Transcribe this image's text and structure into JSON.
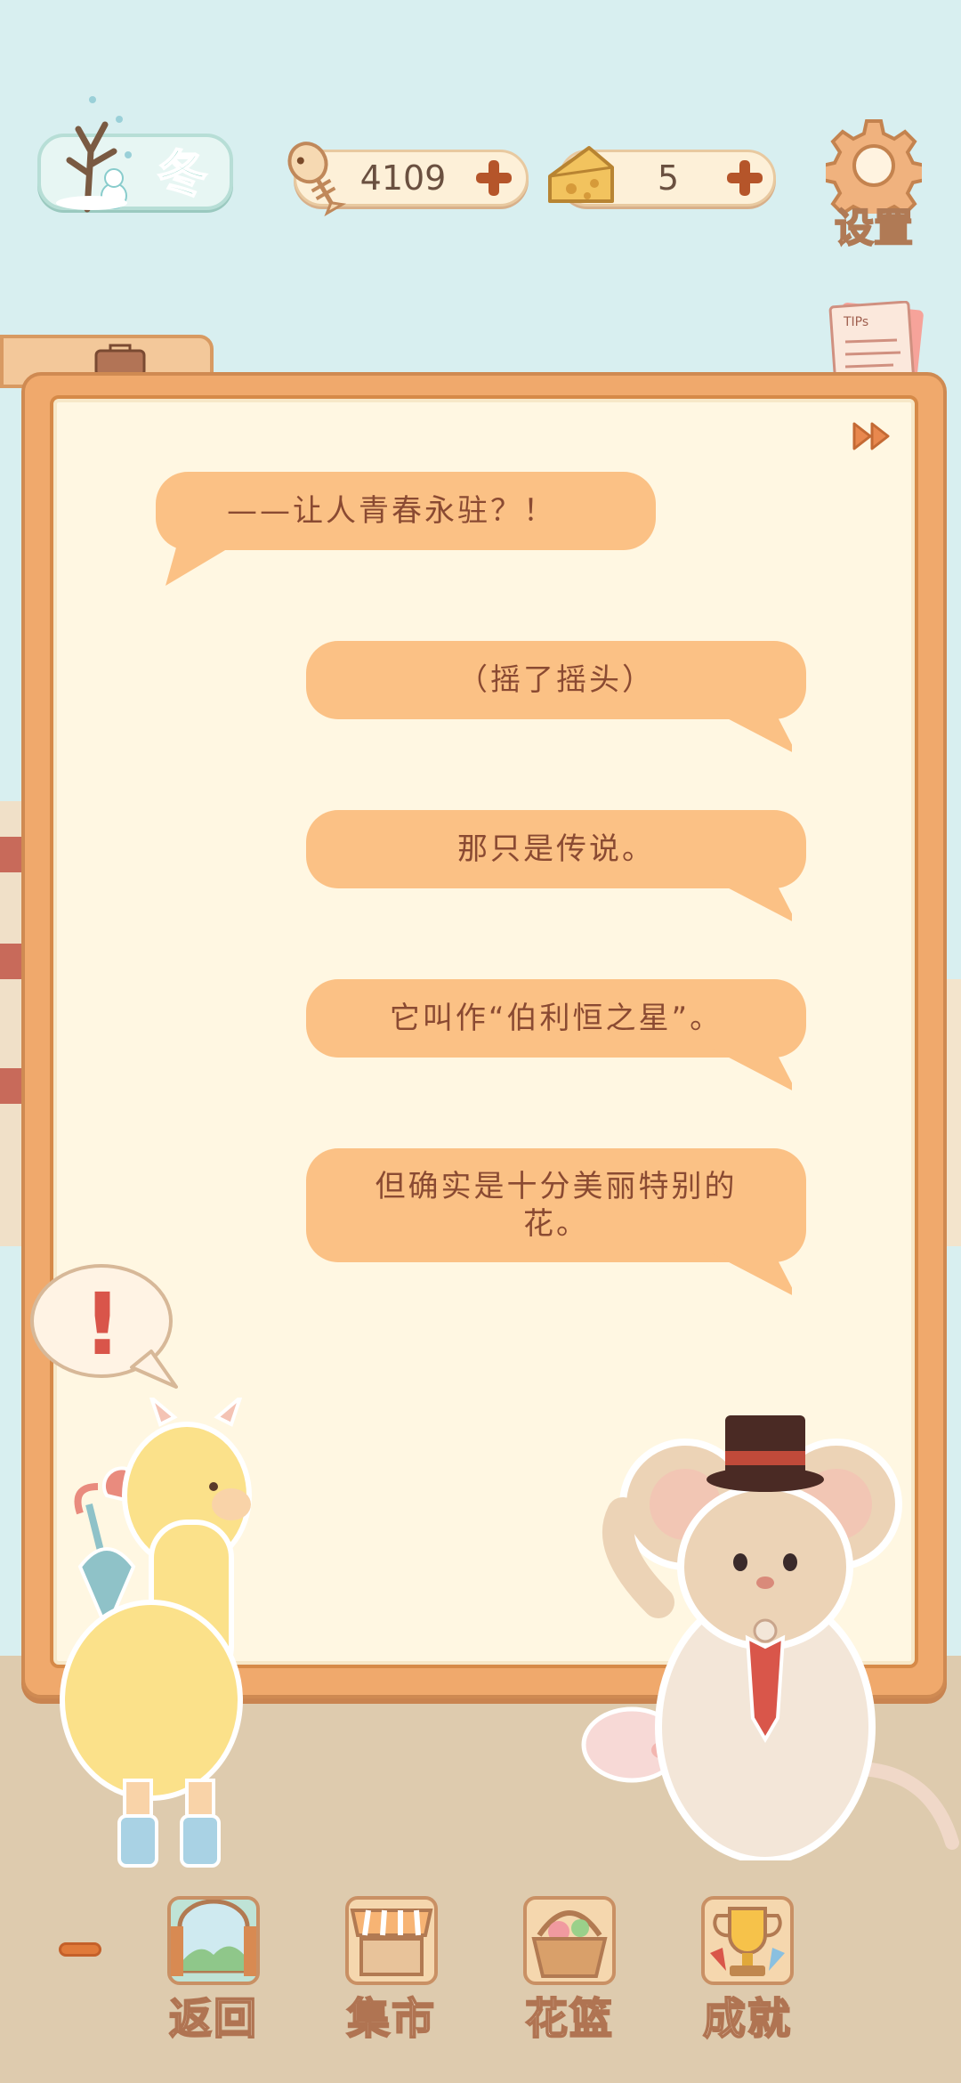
{
  "season": {
    "label": "冬"
  },
  "currency": {
    "fish": {
      "value": "4109",
      "icon": "fish-bone-icon"
    },
    "cheese": {
      "value": "5",
      "icon": "cheese-icon"
    }
  },
  "settings": {
    "label": "设置",
    "icon": "gear-icon"
  },
  "tip": {
    "label": "TIPs"
  },
  "dialogue": [
    {
      "speaker": "left",
      "text": "——让人青春永驻？！"
    },
    {
      "speaker": "right",
      "text": "（摇了摇头）"
    },
    {
      "speaker": "right",
      "text": "那只是传说。"
    },
    {
      "speaker": "right",
      "text": "它叫作“伯利恒之星”。"
    },
    {
      "speaker": "right",
      "text": "但确实是十分美丽特别的花。"
    }
  ],
  "exclaim": {
    "text": "!"
  },
  "nav": {
    "back": "返回",
    "market": "集市",
    "basket": "花篮",
    "achievement": "成就"
  },
  "colors": {
    "bubble": "#fbc185",
    "bubble_text": "#8a4a32",
    "panel_border": "#f0a96c",
    "panel_bg": "#fff7e2",
    "sky": "#d8eff0",
    "ground": "#decbae"
  }
}
